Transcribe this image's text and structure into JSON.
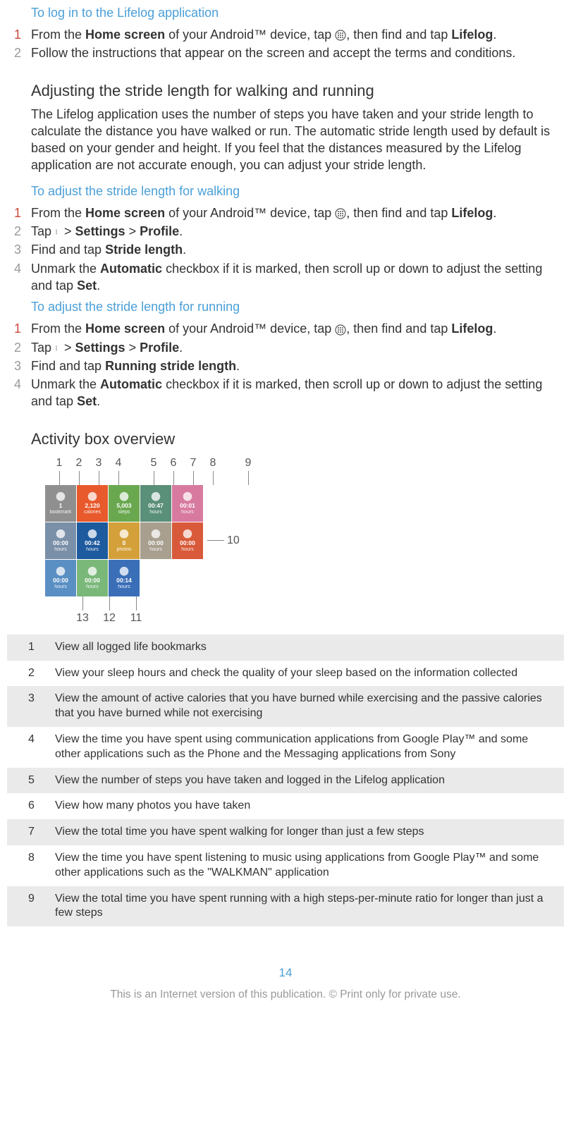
{
  "sect1": {
    "title": "To log in to the Lifelog application",
    "steps": [
      {
        "n": "1",
        "pre": "From the ",
        "b1": "Home screen",
        " mid": " of your Android™ device, tap ",
        "post": ", then find and tap ",
        "b2": "Lifelog",
        "end": "."
      },
      {
        "n": "2",
        "text": "Follow the instructions that appear on the screen and accept the terms and conditions."
      }
    ]
  },
  "sect2": {
    "heading": "Adjusting the stride length for walking and running",
    "para": "The Lifelog application uses the number of steps you have taken and your stride length to calculate the distance you have walked or run. The automatic stride length used by default is based on your gender and height. If you feel that the distances measured by the Lifelog application are not accurate enough, you can adjust your stride length."
  },
  "sect3": {
    "title": "To adjust the stride length for walking",
    "s1": {
      "n": "1",
      "pre": "From the ",
      "b1": "Home screen",
      "mid": " of your Android™ device, tap ",
      "post": ", then find and tap ",
      "b2": "Lifelog",
      "end": "."
    },
    "s2": {
      "n": "2",
      "pre": "Tap ",
      "gt1": " > ",
      "b1": "Settings",
      "gt2": " > ",
      "b2": "Profile",
      "end": "."
    },
    "s3": {
      "n": "3",
      "pre": "Find and tap ",
      "b1": "Stride length",
      "end": "."
    },
    "s4": {
      "n": "4",
      "pre": "Unmark the ",
      "b1": "Automatic",
      "mid": " checkbox if it is marked, then scroll up or down to adjust the setting and tap ",
      "b2": "Set",
      "end": "."
    }
  },
  "sect4": {
    "title": "To adjust the stride length for running",
    "s1": {
      "n": "1",
      "pre": "From the ",
      "b1": "Home screen",
      "mid": " of your Android™ device, tap ",
      "post": ", then find and tap ",
      "b2": "Lifelog",
      "end": "."
    },
    "s2": {
      "n": "2",
      "pre": "Tap ",
      "gt1": " > ",
      "b1": "Settings",
      "gt2": " > ",
      "b2": "Profile",
      "end": "."
    },
    "s3": {
      "n": "3",
      "pre": "Find and tap ",
      "b1": "Running stride length",
      "end": "."
    },
    "s4": {
      "n": "4",
      "pre": "Unmark the ",
      "b1": "Automatic",
      "mid": " checkbox if it is marked, then scroll up or down to adjust the setting and tap ",
      "b2": "Set",
      "end": "."
    }
  },
  "activity": {
    "heading": "Activity box overview",
    "top": [
      "1",
      "2",
      "3",
      "4",
      "5",
      "6",
      "7",
      "8",
      "9"
    ],
    "side": "10",
    "bot": [
      "13",
      "12",
      "11"
    ],
    "tiles": [
      {
        "c": "#8f8f8f",
        "v": "1",
        "l": "bookmark"
      },
      {
        "c": "#e85a2c",
        "v": "2,120",
        "l": "calories"
      },
      {
        "c": "#6aa84f",
        "v": "5,003",
        "l": "steps"
      },
      {
        "c": "#5a8f7a",
        "v": "00:47",
        "l": "hours"
      },
      {
        "c": "#d87a9f",
        "v": "00:01",
        "l": "hours"
      },
      {
        "c": "#7a8fa8",
        "v": "00:00",
        "l": "hours"
      },
      {
        "c": "#1e5a9e",
        "v": "00:42",
        "l": "hours"
      },
      {
        "c": "#d4a03a",
        "v": "0",
        "l": "photos"
      },
      {
        "c": "#a89f8f",
        "v": "00:00",
        "l": "hours"
      },
      {
        "c": "#d85a3a",
        "v": "00:00",
        "l": "hours"
      },
      {
        "c": "#5a8fc4",
        "v": "00:00",
        "l": "hours"
      },
      {
        "c": "#7ab87a",
        "v": "00:00",
        "l": "hours"
      },
      {
        "c": "#3a6fb8",
        "v": "00:14",
        "l": "hours"
      }
    ]
  },
  "legend": [
    {
      "n": "1",
      "t": "View all logged life bookmarks"
    },
    {
      "n": "2",
      "t": "View your sleep hours and check the quality of your sleep based on the information collected"
    },
    {
      "n": "3",
      "t": "View the amount of active calories that you have burned while exercising and the passive calories that you have burned while not exercising"
    },
    {
      "n": "4",
      "t": "View the time you have spent using communication applications from Google Play™ and some other applications such as the Phone and the Messaging applications from Sony"
    },
    {
      "n": "5",
      "t": "View the number of steps you have taken and logged in the Lifelog application"
    },
    {
      "n": "6",
      "t": "View how many photos you have taken"
    },
    {
      "n": "7",
      "t": "View the total time you have spent walking for longer than just a few steps"
    },
    {
      "n": "8",
      "t": "View the time you have spent listening to music using applications from Google Play™ and some other applications such as the \"WALKMAN\" application"
    },
    {
      "n": "9",
      "t": "View the total time you have spent running with a high steps-per-minute ratio for longer than just a few steps"
    }
  ],
  "page": "14",
  "footer": "This is an Internet version of this publication. © Print only for private use."
}
